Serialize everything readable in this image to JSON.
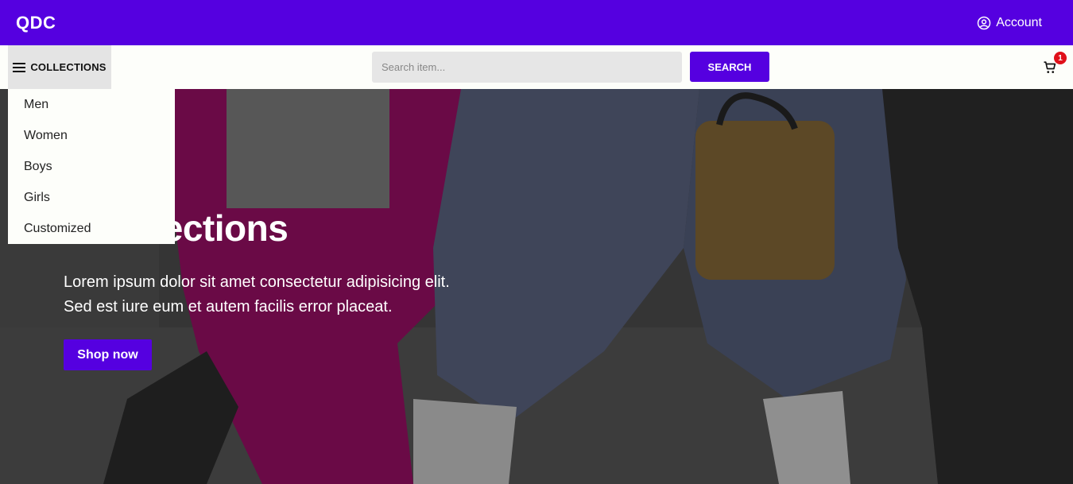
{
  "header": {
    "logo": "QDC",
    "account_label": "Account"
  },
  "navbar": {
    "collections_label": "COLLECTIONS",
    "search_placeholder": "Search item...",
    "search_button": "SEARCH",
    "cart_count": "1"
  },
  "dropdown": {
    "items": [
      "Men",
      "Women",
      "Boys",
      "Girls",
      "Customized"
    ]
  },
  "hero": {
    "title_visible": "n Collections",
    "text": "Lorem ipsum dolor sit amet consectetur adipisicing elit. Sed est iure eum et autem facilis error placeat.",
    "button": "Shop now"
  },
  "colors": {
    "brand": "#5500e0",
    "badge": "#e0101a"
  },
  "icons": {
    "account": "account-circle-icon",
    "menu": "hamburger-menu-icon",
    "cart": "shopping-cart-icon"
  }
}
